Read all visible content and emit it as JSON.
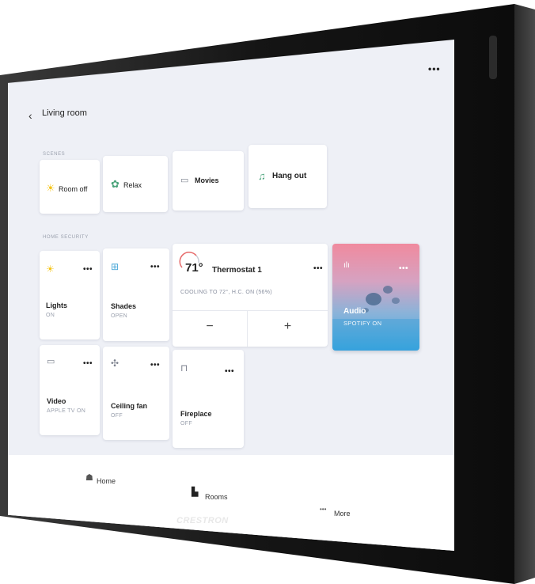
{
  "header": {
    "title": "Living room",
    "more_label": "•••"
  },
  "scenes": {
    "label": "SCENES",
    "items": [
      {
        "label": "Room off",
        "icon": "sun-icon"
      },
      {
        "label": "Relax",
        "icon": "leaf-icon"
      },
      {
        "label": "Movies",
        "icon": "screen-icon"
      },
      {
        "label": "Hang out",
        "icon": "music-icon"
      }
    ]
  },
  "security": {
    "label": "HOME SECURITY",
    "tiles": [
      {
        "title": "Lights",
        "status": "ON",
        "icon": "sun-icon"
      },
      {
        "title": "Shades",
        "status": "OPEN",
        "icon": "shades-icon"
      },
      {
        "title": "Video",
        "status": "APPLE TV ON",
        "icon": "tv-icon"
      },
      {
        "title": "Ceiling fan",
        "status": "OFF",
        "icon": "fan-icon"
      },
      {
        "title": "Fireplace",
        "status": "OFF",
        "icon": "fireplace-icon"
      }
    ],
    "dots": "•••"
  },
  "thermostat": {
    "temp": "71°",
    "name": "Thermostat 1",
    "status": "COOLING TO 72°, H.C. ON (56%)",
    "minus": "−",
    "plus": "+"
  },
  "audio": {
    "title": "Audio",
    "status": "SPOTIFY ON",
    "icon": "equalizer-icon"
  },
  "nav": {
    "home": "Home",
    "rooms": "Rooms",
    "more": "More",
    "more_dots": "•••"
  },
  "brand": "CRESTRON",
  "colors": {
    "bezel": "#1a1a1a",
    "screen_bg": "#eef0f6",
    "audio_top": "#f08a9e",
    "audio_bottom": "#3ca7e0"
  }
}
